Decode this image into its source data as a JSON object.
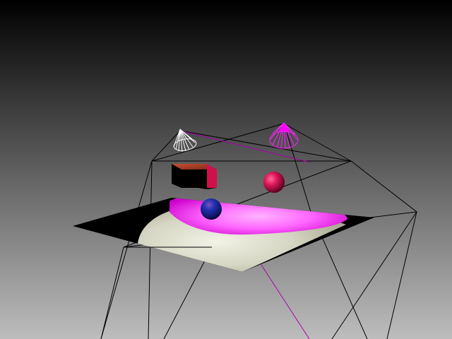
{
  "scene": {
    "background_top_color": "#000000",
    "background_bottom_color": "#bdbdbd",
    "spotlight_colors": [
      "#ffffff",
      "#ff00ff"
    ],
    "objects": [
      {
        "name": "white-spotlight-cone",
        "icon": "spotlight-icon",
        "color": "#ffffff",
        "render": "wireframe"
      },
      {
        "name": "magenta-spotlight-cone",
        "icon": "spotlight-icon",
        "color": "#ff00ff",
        "render": "wireframe"
      },
      {
        "name": "box",
        "icon": "cube-icon",
        "color": "#c4143c",
        "render": "shaded"
      },
      {
        "name": "red-sphere",
        "icon": "sphere-icon",
        "color": "#e0185a",
        "render": "shaded"
      },
      {
        "name": "blue-sphere",
        "icon": "sphere-icon",
        "color": "#1a2aa0",
        "render": "shaded"
      },
      {
        "name": "ground-plane",
        "icon": "plane-icon",
        "color": "#000000",
        "render": "shaded"
      }
    ]
  }
}
